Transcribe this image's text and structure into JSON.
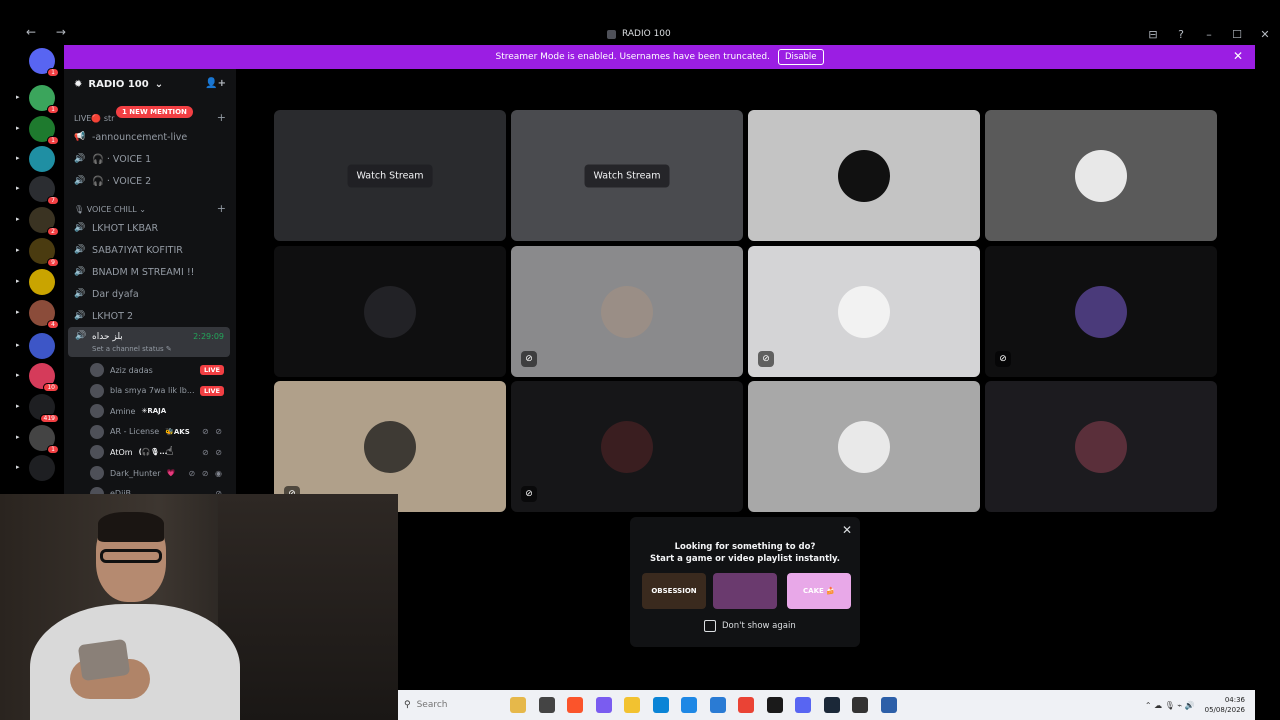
{
  "window": {
    "title": "RADIO 100",
    "nav": "← →",
    "controls": [
      "⊟",
      "?",
      "–",
      "☐",
      "✕"
    ]
  },
  "banner": {
    "text": "Streamer Mode is enabled. Usernames have been truncated.",
    "button": "Disable",
    "close": "✕"
  },
  "servers": [
    {
      "color": "#5865f2",
      "badge": "1",
      "icon": "discord-icon"
    },
    {
      "color": "#3ba55c",
      "badge": "1",
      "icon": "server-icon"
    },
    {
      "color": "#1e7a2e",
      "badge": "1",
      "icon": "server-icon"
    },
    {
      "color": "#1f8fa3",
      "badge": "",
      "icon": "server-icon"
    },
    {
      "color": "#2b2d31",
      "badge": "7",
      "icon": "server-icon"
    },
    {
      "color": "#3a3322",
      "badge": "2",
      "icon": "server-icon"
    },
    {
      "color": "#4a3b10",
      "badge": "9",
      "icon": "server-icon"
    },
    {
      "color": "#c9a400",
      "badge": "",
      "icon": "server-icon"
    },
    {
      "color": "#8b4c3a",
      "badge": "4",
      "icon": "server-icon"
    },
    {
      "color": "#3d56c7",
      "badge": "",
      "icon": "server-icon"
    },
    {
      "color": "#d53b5a",
      "badge": "10",
      "icon": "server-icon"
    },
    {
      "color": "#1e1f22",
      "badge": "419",
      "icon": "server-icon"
    },
    {
      "color": "#444",
      "badge": "1",
      "icon": "server-icon"
    },
    {
      "color": "#1e1f22",
      "badge": "",
      "icon": "server-icon"
    }
  ],
  "guild": {
    "name": "RADIO 100",
    "mention_pill": "1 NEW MENTION",
    "live_category": "LIVE🔴 str",
    "live_channels": [
      {
        "icon": "📢",
        "name": "-announcement-live"
      },
      {
        "icon": "🔊",
        "name": "🎧 · VOICE 1"
      },
      {
        "icon": "🔊",
        "name": "🎧 · VOICE 2"
      }
    ],
    "voice_category": "🎙 VOICE CHILL ⌄",
    "voice_channels": [
      {
        "name": "LKHOT LKBAR"
      },
      {
        "name": "SABA7IYAT KOFITIR"
      },
      {
        "name": "BNADM M STREAMI !!"
      },
      {
        "name": "Dar dyafa"
      },
      {
        "name": "LKHOT 2"
      }
    ],
    "active_vc": {
      "name": "بلز حداه",
      "time": "2:29:09",
      "status": "Set a channel status ✎"
    },
    "members": [
      {
        "name": "Aziz dadas",
        "live": "LIVE",
        "tag": "",
        "icons": ""
      },
      {
        "name": "bla smya 7wa lik lb...",
        "live": "LIVE",
        "tag": "",
        "icons": ""
      },
      {
        "name": "Amine",
        "live": "",
        "tag": "✳RAJA",
        "icons": ""
      },
      {
        "name": "AR - License",
        "live": "",
        "tag": "🐝AKS",
        "icons": "⊘ ⊘"
      },
      {
        "name": "AtOm",
        "live": "",
        "tag": "(🎧🎙...",
        "icons": "⊘ ⊘"
      },
      {
        "name": "Dark_Hunter",
        "live": "",
        "tag": "💗",
        "icons": "⊘ ⊘ ◉"
      },
      {
        "name": "eDiiB",
        "live": "",
        "tag": "",
        "icons": "⊘"
      }
    ]
  },
  "stage": {
    "watch_label": "Watch Stream",
    "tiles": [
      {
        "bg": "#2a2b2e",
        "avatar": "",
        "watch": true,
        "mute": false
      },
      {
        "bg": "#4a4b4f",
        "avatar": "",
        "watch": true,
        "mute": false
      },
      {
        "bg": "#c4c4c4",
        "avatar": "#111111",
        "watch": false,
        "mute": false
      },
      {
        "bg": "#5a5a5a",
        "avatar": "#e8e8e8",
        "watch": false,
        "mute": false
      },
      {
        "bg": "#0f0f10",
        "avatar": "#222226",
        "watch": false,
        "mute": false
      },
      {
        "bg": "#8a8a8c",
        "avatar": "#9a8e86",
        "watch": false,
        "mute": true
      },
      {
        "bg": "#d4d4d6",
        "avatar": "#f2f2f2",
        "watch": false,
        "mute": true
      },
      {
        "bg": "#0f0f10",
        "avatar": "#4a3a7a",
        "watch": false,
        "mute": true
      },
      {
        "bg": "#b0a08a",
        "avatar": "#3e3a34",
        "watch": false,
        "mute": true
      },
      {
        "bg": "#161618",
        "avatar": "#3a1e20",
        "watch": false,
        "mute": true
      },
      {
        "bg": "#a8a8a8",
        "avatar": "#e9e9e9",
        "watch": false,
        "mute": false
      },
      {
        "bg": "#1c1b1f",
        "avatar": "#5a2f3a",
        "watch": false,
        "mute": false
      }
    ]
  },
  "activity": {
    "line1": "Looking for something to do?",
    "line2": "Start a game or video playlist instantly.",
    "thumbs": [
      {
        "label": "OBSESSION",
        "bg": "#3a2a1e"
      },
      {
        "label": "",
        "bg": "#6a3a6e"
      },
      {
        "label": "CAKE 🍰",
        "bg": "#e8a8e8"
      }
    ],
    "dont_show": "Don't show again",
    "close": "✕"
  },
  "taskbar": {
    "search_placeholder": "Search",
    "icons": [
      "#e6b84a",
      "#444444",
      "#fb542b",
      "#7a5cf0",
      "#f2c230",
      "#0a84d6",
      "#1e88e5",
      "#2a7bd4",
      "#ea4335",
      "#1a1a1a",
      "#5865f2",
      "#1b2838",
      "#333333",
      "#2c5fa8"
    ],
    "tray": "⌃ ☁ 🎙 ⌁ 🔊",
    "time": "04:36",
    "date": "05/08/2026"
  }
}
